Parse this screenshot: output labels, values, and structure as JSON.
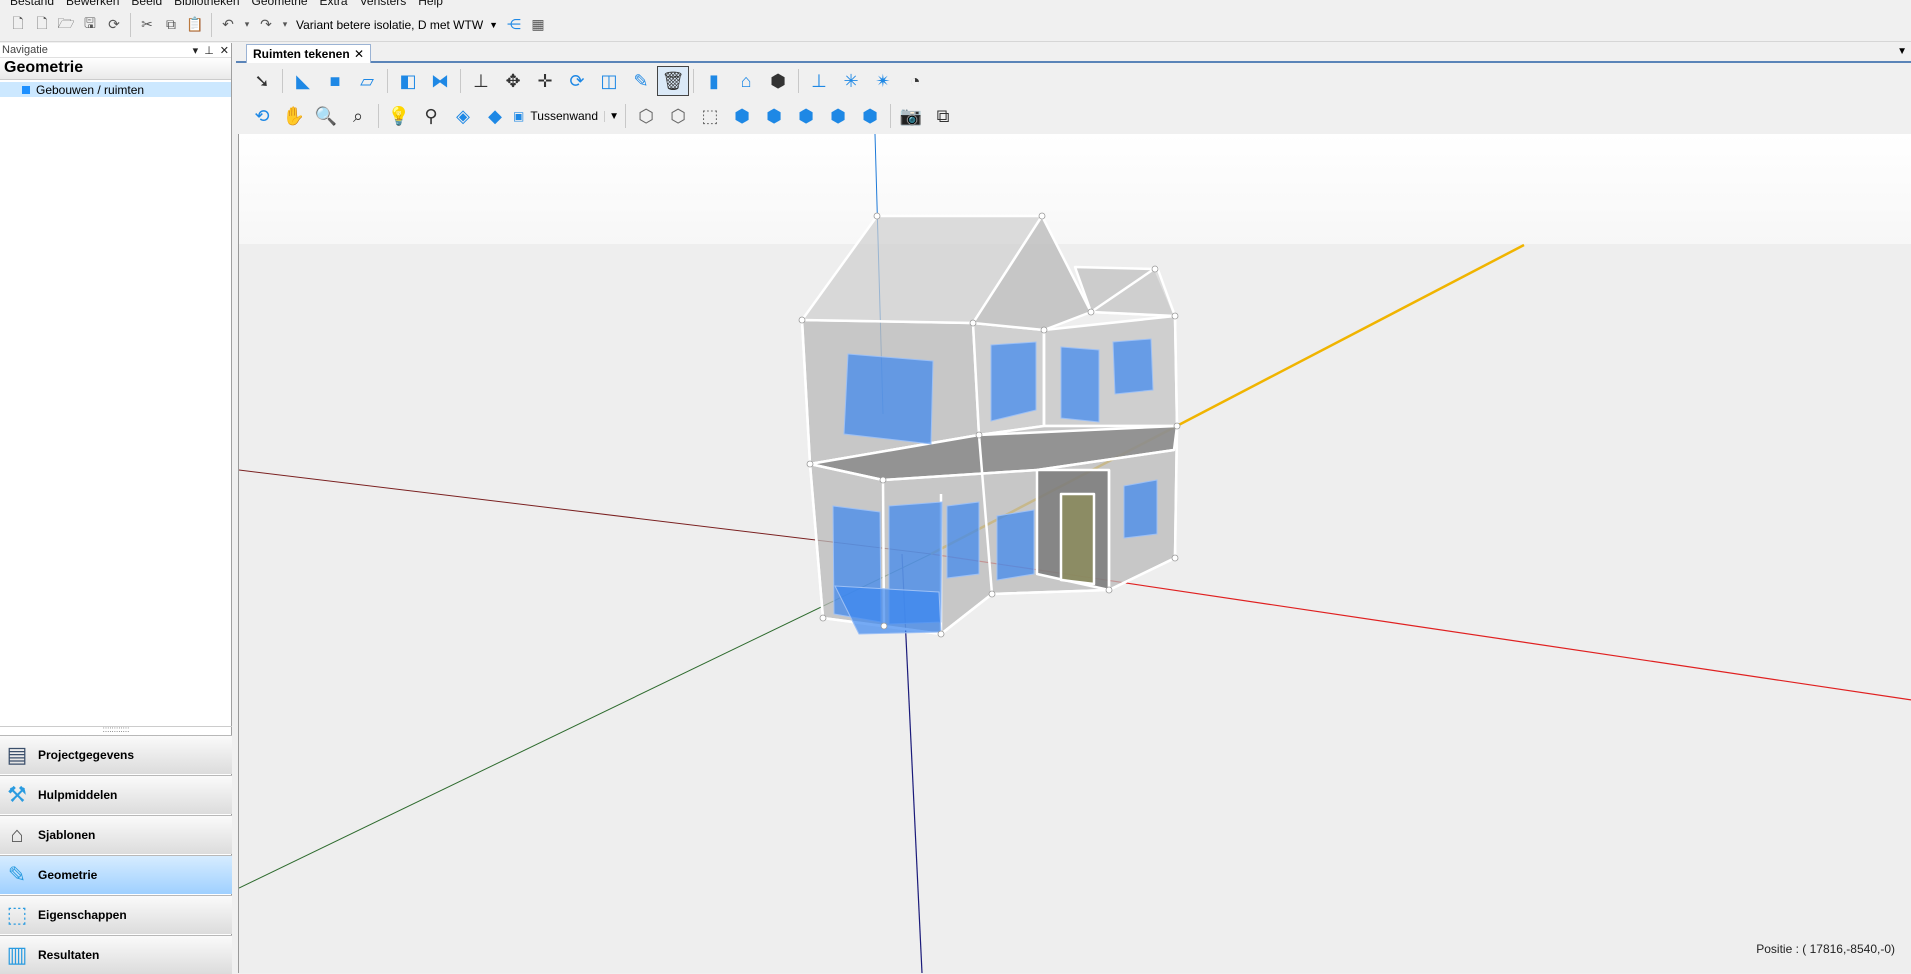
{
  "menu": [
    "Bestand",
    "Bewerken",
    "Beeld",
    "Bibliotheken",
    "Geometrie",
    "Extra",
    "Vensters",
    "Help"
  ],
  "toolbar": {
    "variant_value": "Variant betere isolatie, D met WTW"
  },
  "navigation": {
    "header_label": "Navigatie",
    "title": "Geometrie",
    "tree": [
      {
        "label": "Gebouwen / ruimten"
      }
    ],
    "buttons": [
      {
        "label": "Projectgegevens",
        "icon": "document-icon"
      },
      {
        "label": "Hulpmiddelen",
        "icon": "tools-icon"
      },
      {
        "label": "Sjablonen",
        "icon": "template-icon"
      },
      {
        "label": "Geometrie",
        "icon": "geometry-icon",
        "active": true
      },
      {
        "label": "Eigenschappen",
        "icon": "properties-icon"
      },
      {
        "label": "Resultaten",
        "icon": "results-icon"
      }
    ]
  },
  "document": {
    "tab_label": "Ruimten tekenen"
  },
  "drawing": {
    "wall_type": "Tussenwand"
  },
  "viewport": {
    "position_text": "Positie : ( 17816,-8540,-0)"
  },
  "colors": {
    "accent": "#1e88e5",
    "window_blue": "#3a86f0",
    "axis_x": "#e02020",
    "axis_y": "#2e6b2e",
    "axis_z": "#1a1a7a",
    "axis_highlight": "#f0b400"
  }
}
